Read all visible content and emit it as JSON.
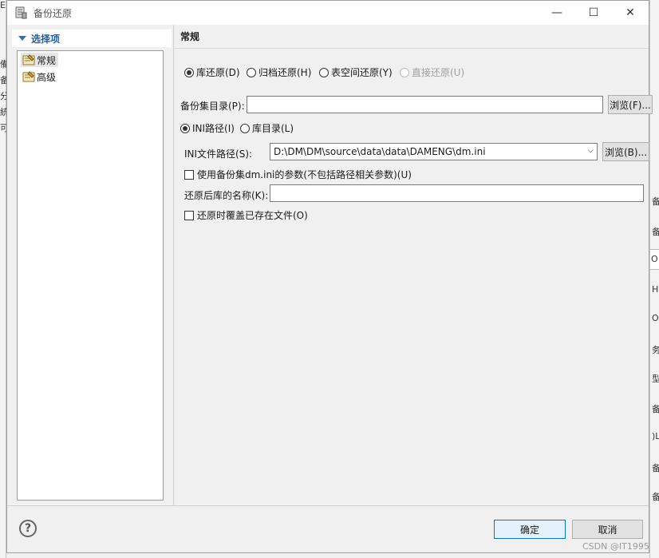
{
  "window": {
    "title": "备份还原",
    "minimize": "—",
    "maximize": "☐",
    "close": "✕"
  },
  "left_pane": {
    "header": "选择项",
    "items": [
      {
        "label": "常规",
        "selected": true
      },
      {
        "label": "高级",
        "selected": false
      }
    ]
  },
  "main": {
    "section_title": "常规",
    "restore_types": [
      {
        "label": "库还原(D)",
        "checked": true,
        "disabled": false
      },
      {
        "label": "归档还原(H)",
        "checked": false,
        "disabled": false
      },
      {
        "label": "表空间还原(Y)",
        "checked": false,
        "disabled": false
      },
      {
        "label": "直接还原(U)",
        "checked": false,
        "disabled": true
      }
    ],
    "backup_dir_label": "备份集目录(P):",
    "backup_dir_value": "",
    "browse_p_label": "浏览(F)...",
    "path_modes": [
      {
        "label": "INI路径(I)",
        "checked": true
      },
      {
        "label": "库目录(L)",
        "checked": false
      }
    ],
    "ini_path_label": "INI文件路径(S):",
    "ini_path_value": "D:\\DM\\DM\\source\\data\\data\\DAMENG\\dm.ini",
    "browse_b_label": "浏览(B)...",
    "use_params_label": "使用备份集dm.ini的参数(不包括路径相关参数)(U)",
    "use_params_checked": false,
    "db_name_label": "还原后库的名称(K):",
    "db_name_value": "",
    "overwrite_label": "还原时覆盖已存在文件(O)",
    "overwrite_checked": false
  },
  "footer": {
    "help": "?",
    "ok": "确定",
    "cancel": "取消",
    "watermark": "CSDN @IT1995"
  },
  "colors": {
    "accent": "#0078d7",
    "header_text": "#1c5fa8"
  }
}
